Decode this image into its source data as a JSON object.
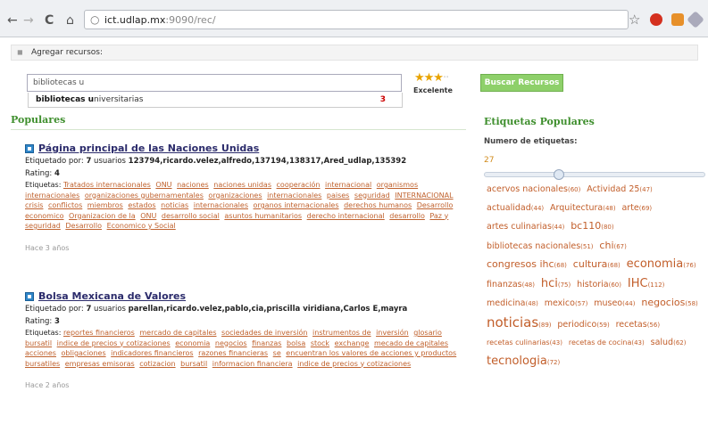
{
  "browser": {
    "url_host": "ict.udlap.mx",
    "url_rest": ":9090/rec/"
  },
  "agregar": {
    "label": "Agregar recursos:"
  },
  "search": {
    "value": "bibliotecas u",
    "suggestion_bold": "bibliotecas u",
    "suggestion_rest": "niversitarias",
    "suggestion_count": "3",
    "rating_label": "Excelente",
    "button_label": "Buscar Recursos"
  },
  "populares": {
    "title": "Populares",
    "items": [
      {
        "title": "Página principal de las Naciones Unidas",
        "tagged_prefix": "Etiquetado por: ",
        "tagged_count": "7",
        "tagged_mid": " usuarios ",
        "tagged_users": "123794,ricardo.velez,alfredo,137194,138317,Ared_udlap,135392",
        "rating_label": "Rating: ",
        "rating": "4",
        "tags_label": "Etiquetas: ",
        "tags": [
          "Tratados internacionales",
          "ONU",
          "naciones",
          "naciones unidas",
          "cooperación",
          "internacional",
          "organismos internacionales",
          "organizaciones gubernamentales",
          "organizaciones",
          "internacionales",
          "paises",
          "seguridad",
          "INTERNACIONAL",
          "crisis",
          "conflictos",
          "miembros",
          "estados",
          "noticias",
          "internacionales",
          "organos internacionales",
          "derechos humanos",
          "Desarrollo economico",
          "Organizacion de la",
          "ONU",
          "desarrollo social",
          "asuntos humanitarios",
          "derecho internacional",
          "desarrollo",
          "Paz y seguridad",
          "Desarrollo",
          "Economico y Social"
        ],
        "time": "Hace 3 años"
      },
      {
        "title": "Bolsa Mexicana de Valores",
        "tagged_prefix": "Etiquetado por: ",
        "tagged_count": "7",
        "tagged_mid": " usuarios ",
        "tagged_users": "parellan,ricardo.velez,pablo,cia,priscilla viridiana,Carlos E,mayra",
        "rating_label": "Rating: ",
        "rating": "3",
        "tags_label": "Etiquetas: ",
        "tags": [
          "reportes financieros",
          "mercado de capitales",
          "sociedades de inversión",
          "instrumentos de",
          "inversión",
          "glosario bursatil",
          "indice de precios y cotizaciones",
          "economia",
          "negocios",
          "finanzas",
          "bolsa",
          "stock",
          "exchange",
          "mecado de capitales",
          "acciones",
          "obligaciones",
          "indicadores financieros",
          "razones financieras",
          "se",
          "encuentran los valores de acciones y productos bursatiles",
          "empresas emisoras",
          "cotizacion",
          "bursatil",
          "informacion financiera",
          "indice de precios y cotizaciones"
        ],
        "time": "Hace 2 años"
      }
    ]
  },
  "etiquetas": {
    "title": "Etiquetas Populares",
    "num_label": "Numero de etiquetas:",
    "num_value": "27",
    "slider_value": 0.33,
    "tags": [
      {
        "name": "acervos nacionales",
        "count": "(60)",
        "size": 2
      },
      {
        "name": "Actividad 25",
        "count": "(47)",
        "size": 2
      },
      {
        "name": "actualidad",
        "count": "(44)",
        "size": 2
      },
      {
        "name": "Arquitectura",
        "count": "(48)",
        "size": 2
      },
      {
        "name": "arte",
        "count": "(69)",
        "size": 2
      },
      {
        "name": "artes culinarias",
        "count": "(44)",
        "size": 2
      },
      {
        "name": "bc110",
        "count": "(80)",
        "size": 3
      },
      {
        "name": "bibliotecas nacionales",
        "count": "(51)",
        "size": 2
      },
      {
        "name": "chi",
        "count": "(67)",
        "size": 3
      },
      {
        "name": "congresos ihc",
        "count": "(68)",
        "size": 3
      },
      {
        "name": "cultura",
        "count": "(68)",
        "size": 3
      },
      {
        "name": "economia",
        "count": "(76)",
        "size": 4
      },
      {
        "name": "finanzas",
        "count": "(48)",
        "size": 2
      },
      {
        "name": "hci",
        "count": "(75)",
        "size": 4
      },
      {
        "name": "historia",
        "count": "(60)",
        "size": 2
      },
      {
        "name": "IHC",
        "count": "(112)",
        "size": 4
      },
      {
        "name": "medicina",
        "count": "(48)",
        "size": 2
      },
      {
        "name": "mexico",
        "count": "(57)",
        "size": 2
      },
      {
        "name": "museo",
        "count": "(44)",
        "size": 2
      },
      {
        "name": "negocios",
        "count": "(58)",
        "size": 3
      },
      {
        "name": "noticias",
        "count": "(89)",
        "size": 5
      },
      {
        "name": "periodico",
        "count": "(59)",
        "size": 2
      },
      {
        "name": "recetas",
        "count": "(56)",
        "size": 2
      },
      {
        "name": "recetas culinarias",
        "count": "(43)",
        "size": 1
      },
      {
        "name": "recetas de cocina",
        "count": "(43)",
        "size": 1
      },
      {
        "name": "salud",
        "count": "(62)",
        "size": 2
      },
      {
        "name": "tecnologia",
        "count": "(72)",
        "size": 4
      }
    ]
  }
}
